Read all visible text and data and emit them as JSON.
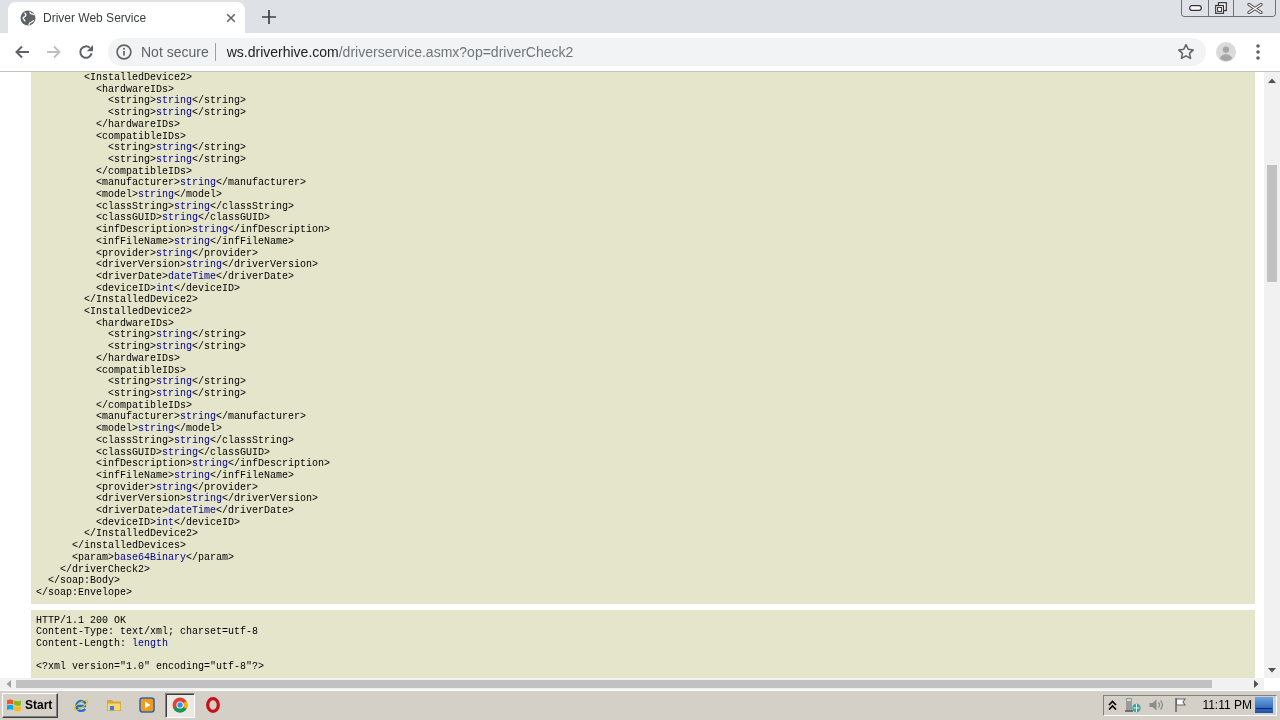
{
  "tabs": [
    {
      "title": "Driver Web Service",
      "selected": true
    }
  ],
  "toolbar": {
    "nav_buttons": [
      {
        "kind": "back",
        "disabled": false
      },
      {
        "kind": "forward",
        "disabled": true
      },
      {
        "kind": "reload",
        "disabled": false
      }
    ],
    "security": "Not secure",
    "url": {
      "host": "ws.driverhive.com",
      "path": "/driverservice.asmx?op=driverCheck2"
    }
  },
  "page": {
    "soap_xml": [
      {
        "close": "</soap:Envelope>",
        "children": [
          {
            "close": "</soap:Body>",
            "children": [
              {
                "close": "</driverCheck2>",
                "children": [
                  {
                    "close": "</installedDevices>",
                    "children": [
                      {
                        "open": "<InstalledDevice2>",
                        "close": "</InstalledDevice2>",
                        "children": [
                          {
                            "open": "<hardwareIDs>",
                            "close": "</hardwareIDs>",
                            "children": [
                              {
                                "open": "<string>",
                                "value": "string",
                                "close": "</string>"
                              },
                              {
                                "open": "<string>",
                                "value": "string",
                                "close": "</string>"
                              }
                            ]
                          },
                          {
                            "open": "<compatibleIDs>",
                            "close": "</compatibleIDs>",
                            "children": [
                              {
                                "open": "<string>",
                                "value": "string",
                                "close": "</string>"
                              },
                              {
                                "open": "<string>",
                                "value": "string",
                                "close": "</string>"
                              }
                            ]
                          },
                          {
                            "open": "<manufacturer>",
                            "value": "string",
                            "close": "</manufacturer>"
                          },
                          {
                            "open": "<model>",
                            "value": "string",
                            "close": "</model>"
                          },
                          {
                            "open": "<classString>",
                            "value": "string",
                            "close": "</classString>"
                          },
                          {
                            "open": "<classGUID>",
                            "value": "string",
                            "close": "</classGUID>"
                          },
                          {
                            "open": "<infDescription>",
                            "value": "string",
                            "close": "</infDescription>"
                          },
                          {
                            "open": "<infFileName>",
                            "value": "string",
                            "close": "</infFileName>"
                          },
                          {
                            "open": "<provider>",
                            "value": "string",
                            "close": "</provider>"
                          },
                          {
                            "open": "<driverVersion>",
                            "value": "string",
                            "close": "</driverVersion>"
                          },
                          {
                            "open": "<driverDate>",
                            "value": "dateTime",
                            "close": "</driverDate>"
                          },
                          {
                            "open": "<deviceID>",
                            "value": "int",
                            "close": "</deviceID>"
                          }
                        ]
                      },
                      {
                        "open": "<InstalledDevice2>",
                        "close": "</InstalledDevice2>",
                        "children": [
                          {
                            "open": "<hardwareIDs>",
                            "close": "</hardwareIDs>",
                            "children": [
                              {
                                "open": "<string>",
                                "value": "string",
                                "close": "</string>"
                              },
                              {
                                "open": "<string>",
                                "value": "string",
                                "close": "</string>"
                              }
                            ]
                          },
                          {
                            "open": "<compatibleIDs>",
                            "close": "</compatibleIDs>",
                            "children": [
                              {
                                "open": "<string>",
                                "value": "string",
                                "close": "</string>"
                              },
                              {
                                "open": "<string>",
                                "value": "string",
                                "close": "</string>"
                              }
                            ]
                          },
                          {
                            "open": "<manufacturer>",
                            "value": "string",
                            "close": "</manufacturer>"
                          },
                          {
                            "open": "<model>",
                            "value": "string",
                            "close": "</model>"
                          },
                          {
                            "open": "<classString>",
                            "value": "string",
                            "close": "</classString>"
                          },
                          {
                            "open": "<classGUID>",
                            "value": "string",
                            "close": "</classGUID>"
                          },
                          {
                            "open": "<infDescription>",
                            "value": "string",
                            "close": "</infDescription>"
                          },
                          {
                            "open": "<infFileName>",
                            "value": "string",
                            "close": "</infFileName>"
                          },
                          {
                            "open": "<provider>",
                            "value": "string",
                            "close": "</provider>"
                          },
                          {
                            "open": "<driverVersion>",
                            "value": "string",
                            "close": "</driverVersion>"
                          },
                          {
                            "open": "<driverDate>",
                            "value": "dateTime",
                            "close": "</driverDate>"
                          },
                          {
                            "open": "<deviceID>",
                            "value": "int",
                            "close": "</deviceID>"
                          }
                        ]
                      }
                    ]
                  },
                  {
                    "open": "<param>",
                    "value": "base64Binary",
                    "close": "</param>"
                  }
                ]
              }
            ]
          }
        ]
      }
    ],
    "response": {
      "headers": [
        {
          "text": "HTTP/1.1 200 OK"
        },
        {
          "text": "Content-Type: text/xml; charset=utf-8"
        },
        {
          "text": "Content-Length:",
          "value": "length"
        }
      ],
      "body": [
        {
          "text": "<?xml version=\"1.0\" encoding=\"utf-8\"?>"
        }
      ]
    }
  },
  "taskbar": {
    "start": "Start",
    "apps": [
      {
        "kind": "ebrowser",
        "selected": false
      },
      {
        "kind": "folder",
        "selected": false
      },
      {
        "kind": "player",
        "selected": false
      },
      {
        "kind": "ring",
        "selected": true
      },
      {
        "kind": "oring",
        "selected": false
      }
    ],
    "clock": "11:11 PM"
  }
}
